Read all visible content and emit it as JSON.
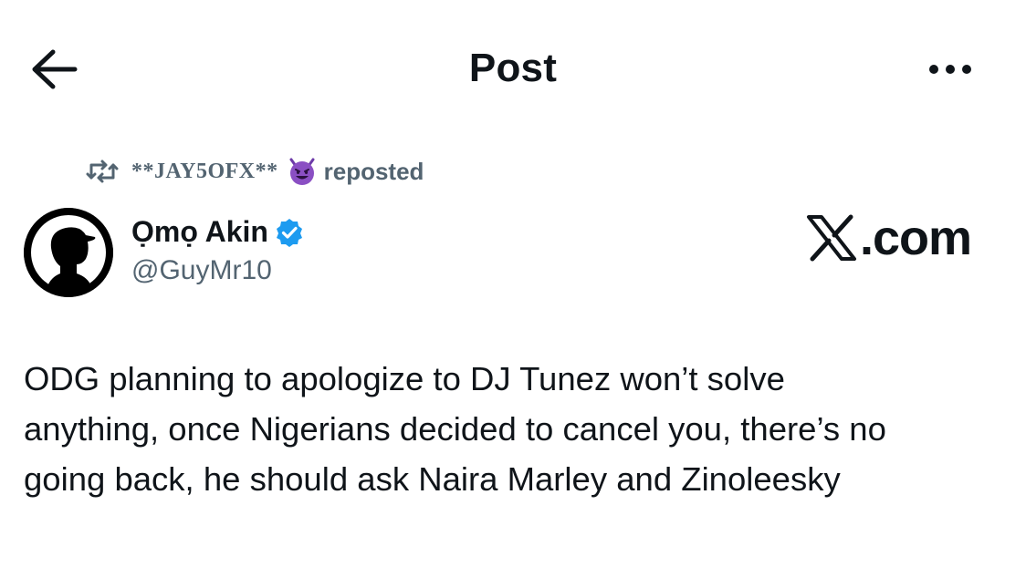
{
  "header": {
    "back_icon": "arrow-left-icon",
    "title": "Post",
    "more_icon": "more-horizontal-icon"
  },
  "repost": {
    "icon": "repost-icon",
    "reposter": "**JAY5OFX**",
    "emoji": "smiling-devil-icon",
    "label": "reposted"
  },
  "author": {
    "avatar_icon": "avatar-silhouette",
    "name": "Ọmọ Akin",
    "verified_icon": "verified-badge-icon",
    "handle": "@GuyMr10"
  },
  "brand": {
    "logo_icon": "x-logo-icon",
    "text": ".com"
  },
  "post": {
    "lines": [
      "ODG planning to apologize to DJ Tunez won’t solve",
      "anything, once Nigerians decided to cancel you, there’s no",
      "going back, he should ask Naira Marley and Zinoleesky"
    ]
  },
  "colors": {
    "text": "#0f1419",
    "secondary": "#536471",
    "verified": "#1d9bf0",
    "emoji_purple": "#8a4fc3"
  }
}
